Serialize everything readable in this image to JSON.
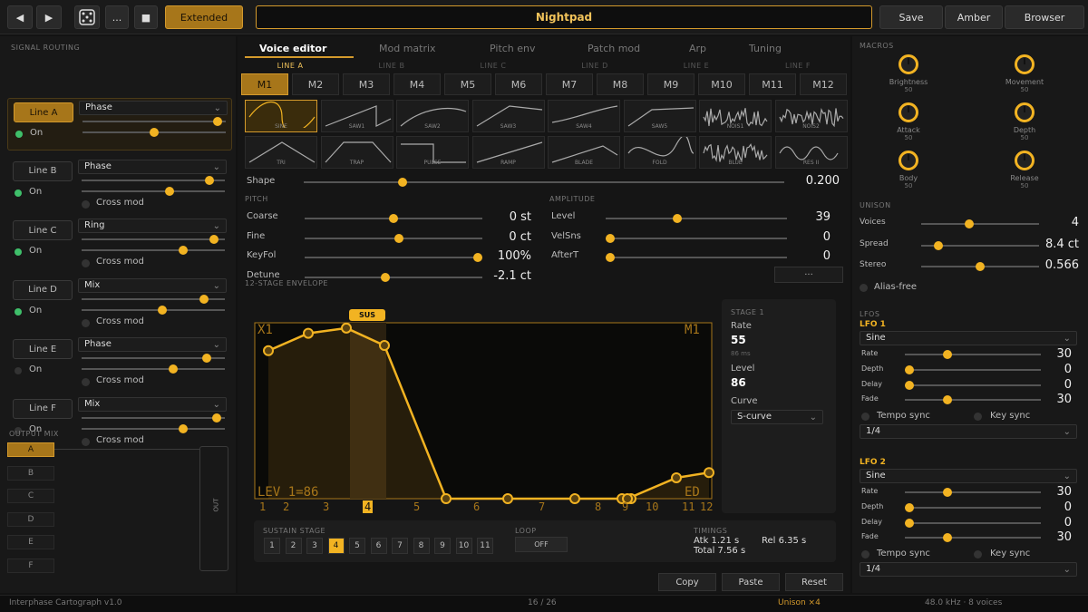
{
  "topbar": {
    "prev_icon": "◀",
    "next_icon": "▶",
    "dice_icon": "dice-icon",
    "more_label": "...",
    "stop_icon": "■",
    "mode_label": "Extended",
    "patch_name": "Nightpad",
    "save_label": "Save",
    "theme_label": "Amber",
    "browser_label": "Browser"
  },
  "signal_routing": {
    "title": "SIGNAL ROUTING",
    "lines": [
      {
        "label": "Line A",
        "mode": "Phase",
        "on_label": "On",
        "enabled": true,
        "cross_mod": null,
        "l": 0.97,
        "r": 0.5
      },
      {
        "label": "Line B",
        "mode": "Phase",
        "on_label": "On",
        "enabled": true,
        "cross_mod": "Cross mod",
        "l": 0.92,
        "r": 0.62
      },
      {
        "label": "Line C",
        "mode": "Ring",
        "on_label": "On",
        "enabled": true,
        "cross_mod": "Cross mod",
        "l": 0.95,
        "r": 0.72
      },
      {
        "label": "Line D",
        "mode": "Mix",
        "on_label": "On",
        "enabled": true,
        "cross_mod": "Cross mod",
        "l": 0.88,
        "r": 0.57
      },
      {
        "label": "Line E",
        "mode": "Phase",
        "on_label": "On",
        "enabled": false,
        "cross_mod": "Cross mod",
        "l": 0.9,
        "r": 0.65
      },
      {
        "label": "Line F",
        "mode": "Mix",
        "on_label": "On",
        "enabled": false,
        "cross_mod": "Cross mod",
        "l": 0.97,
        "r": 0.72
      }
    ]
  },
  "output_mix": {
    "title": "OUTPUT MIX",
    "buttons": [
      "A",
      "B",
      "C",
      "D",
      "E",
      "F"
    ],
    "out_label": "OUT"
  },
  "tabs": [
    "Voice editor",
    "Mod matrix",
    "Pitch env",
    "Patch mod",
    "Arp",
    "Tuning"
  ],
  "line_tabs": [
    "LINE A",
    "LINE B",
    "LINE C",
    "LINE D",
    "LINE E",
    "LINE F"
  ],
  "operators": [
    "M1",
    "M2",
    "M3",
    "M4",
    "M5",
    "M6",
    "M7",
    "M8",
    "M9",
    "M10",
    "M11",
    "M12"
  ],
  "waves": [
    "SINE",
    "SAW1",
    "SAW2",
    "SAW3",
    "SAW4",
    "SAW5",
    "NOIS1",
    "NOIS2",
    "TRI",
    "TRAP",
    "PULSE",
    "RAMP",
    "BLADE",
    "FOLD",
    "BLUE",
    "RES II"
  ],
  "shape": {
    "label": "Shape",
    "value": "0.200",
    "level": 0.2
  },
  "pitch": {
    "title": "PITCH",
    "rows": [
      {
        "label": "Coarse",
        "value": "0 st",
        "level": 0.5
      },
      {
        "label": "Fine",
        "value": "0 ct",
        "level": 0.53
      },
      {
        "label": "KeyFol",
        "value": "100%",
        "level": 1.0
      },
      {
        "label": "Detune",
        "value": "-2.1 ct",
        "level": 0.45
      }
    ]
  },
  "amplitude": {
    "title": "AMPLITUDE",
    "rows": [
      {
        "label": "Level",
        "value": "39",
        "level": 0.39
      },
      {
        "label": "VelSns",
        "value": "0",
        "level": 0.0
      },
      {
        "label": "AfterT",
        "value": "0",
        "level": 0.0
      }
    ],
    "more_label": "..."
  },
  "envelope": {
    "title": "12-STAGE ENVELOPE",
    "sus_label": "SUS",
    "corner_tl": "X1",
    "corner_tr": "M1",
    "corner_bl": "LEV 1=86",
    "corner_br": "ED",
    "stage_numbers": [
      "1",
      "2",
      "3",
      "4",
      "5",
      "6",
      "7",
      "8",
      "9",
      "10",
      "11",
      "12"
    ],
    "points": [
      0.85,
      0.95,
      0.98,
      0.88,
      0.0,
      0.0,
      0.0,
      0.0,
      0.0,
      0.0,
      0.12,
      0.15
    ],
    "stage_panel": {
      "title": "STAGE 1",
      "rate_label": "Rate",
      "rate_value": "55",
      "rate_sub": "86 ms",
      "level_label": "Level",
      "level_value": "86",
      "curve_label": "Curve",
      "curve_value": "S-curve"
    }
  },
  "sustain": {
    "title": "SUSTAIN STAGE",
    "stages": [
      "1",
      "2",
      "3",
      "4",
      "5",
      "6",
      "7",
      "8",
      "9",
      "10",
      "11"
    ],
    "active": 3,
    "loop_label": "LOOP",
    "loop_value": "OFF",
    "timings_label": "TIMINGS",
    "atk": "Atk 1.21 s",
    "rel": "Rel 6.35 s",
    "total": "Total 7.56 s"
  },
  "actions": {
    "copy": "Copy",
    "paste": "Paste",
    "reset": "Reset"
  },
  "macros": {
    "title": "MACROS",
    "items": [
      {
        "name": "Brightness",
        "value": "50"
      },
      {
        "name": "Movement",
        "value": "50"
      },
      {
        "name": "Attack",
        "value": "50"
      },
      {
        "name": "Depth",
        "value": "50"
      },
      {
        "name": "Body",
        "value": "50"
      },
      {
        "name": "Release",
        "value": "50"
      }
    ]
  },
  "unison": {
    "title": "UNISON",
    "rows": [
      {
        "label": "Voices",
        "value": "4",
        "level": 0.4
      },
      {
        "label": "Spread",
        "value": "8.4 ct",
        "level": 0.12
      },
      {
        "label": "Stereo",
        "value": "0.566",
        "level": 0.5
      }
    ],
    "alias_label": "Alias-free"
  },
  "lfos": {
    "title": "LFOS",
    "items": [
      {
        "name": "LFO 1",
        "wave": "Sine",
        "rows": [
          {
            "label": "Rate",
            "value": "30",
            "level": 0.3
          },
          {
            "label": "Depth",
            "value": "0",
            "level": 0.0
          },
          {
            "label": "Delay",
            "value": "0",
            "level": 0.0
          },
          {
            "label": "Fade",
            "value": "30",
            "level": 0.3
          }
        ],
        "tempo_label": "Tempo sync",
        "key_label": "Key sync",
        "division": "1/4"
      },
      {
        "name": "LFO 2",
        "wave": "Sine",
        "rows": [
          {
            "label": "Rate",
            "value": "30",
            "level": 0.3
          },
          {
            "label": "Depth",
            "value": "0",
            "level": 0.0
          },
          {
            "label": "Delay",
            "value": "0",
            "level": 0.0
          },
          {
            "label": "Fade",
            "value": "30",
            "level": 0.3
          }
        ],
        "tempo_label": "Tempo sync",
        "key_label": "Key sync",
        "division": "1/4"
      }
    ]
  },
  "status": {
    "app": "Interphase Cartograph v1.0",
    "page": "16 / 26",
    "unison": "Unison ×4",
    "engine": "48.0 kHz · 8 voices"
  }
}
